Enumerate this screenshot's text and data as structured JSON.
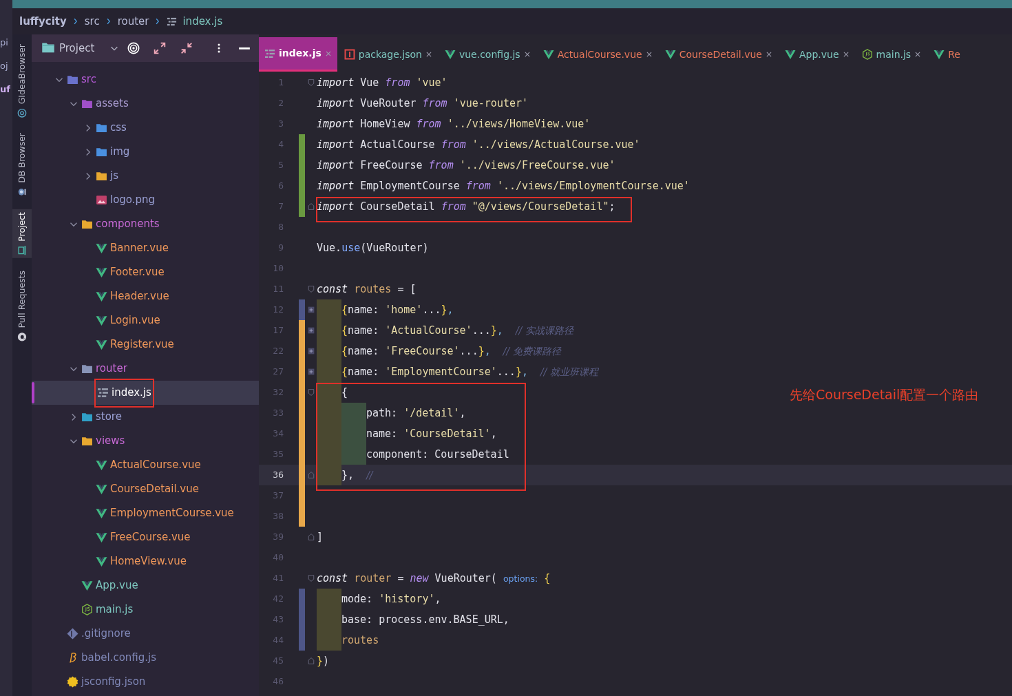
{
  "background_window": {
    "fragments": [
      "pi",
      "oj",
      "uf"
    ]
  },
  "breadcrumb": [
    {
      "label": "luffycity",
      "kind": "project"
    },
    {
      "label": "src",
      "kind": "folder"
    },
    {
      "label": "router",
      "kind": "folder"
    },
    {
      "label": "index.js",
      "kind": "file"
    }
  ],
  "tool_strip": [
    {
      "label": "GIdeaBrowser",
      "selected": false
    },
    {
      "label": "DB Browser",
      "selected": false
    },
    {
      "label": "Project",
      "selected": true
    },
    {
      "label": "Pull Requests",
      "selected": false
    }
  ],
  "project_panel": {
    "title": "Project",
    "tree": [
      {
        "label": "src",
        "kind": "src",
        "color": "#b45ad6",
        "expanded": true,
        "selected": false,
        "children": [
          {
            "label": "assets",
            "kind": "assets",
            "color": "#a99bd0",
            "expanded": true,
            "selected": false,
            "children": [
              {
                "label": "css",
                "kind": "styles",
                "color": "#9aa0d4",
                "expanded": false,
                "selected": false
              },
              {
                "label": "img",
                "kind": "images",
                "color": "#9aa0d4",
                "expanded": false,
                "selected": false
              },
              {
                "label": "js",
                "kind": "scripts",
                "color": "#9aa0d4",
                "expanded": false,
                "selected": false
              },
              {
                "label": "logo.png",
                "kind": "image",
                "color": "#9aa0d4",
                "selected": false
              }
            ]
          },
          {
            "label": "components",
            "kind": "components",
            "color": "#c86ad6",
            "expanded": true,
            "selected": false,
            "children": [
              {
                "label": "Banner.vue",
                "kind": "vue",
                "color": "#f0985a",
                "selected": false
              },
              {
                "label": "Footer.vue",
                "kind": "vue",
                "color": "#f0985a",
                "selected": false
              },
              {
                "label": "Header.vue",
                "kind": "vue",
                "color": "#f0985a",
                "selected": false
              },
              {
                "label": "Login.vue",
                "kind": "vue",
                "color": "#f0985a",
                "selected": false
              },
              {
                "label": "Register.vue",
                "kind": "vue",
                "color": "#f0985a",
                "selected": false
              }
            ]
          },
          {
            "label": "router",
            "kind": "router",
            "color": "#c86ad6",
            "expanded": true,
            "selected": false,
            "children": [
              {
                "label": "index.js",
                "kind": "list",
                "color": "#ffffff",
                "selected": true,
                "boxed": true
              }
            ]
          },
          {
            "label": "store",
            "kind": "store",
            "color": "#9aa0d4",
            "expanded": false,
            "selected": false
          },
          {
            "label": "views",
            "kind": "views",
            "color": "#c86ad6",
            "expanded": true,
            "selected": false,
            "children": [
              {
                "label": "ActualCourse.vue",
                "kind": "vue",
                "color": "#f0985a",
                "selected": false
              },
              {
                "label": "CourseDetail.vue",
                "kind": "vue",
                "color": "#f0985a",
                "selected": false
              },
              {
                "label": "EmploymentCourse.vue",
                "kind": "vue",
                "color": "#f0985a",
                "selected": false
              },
              {
                "label": "FreeCourse.vue",
                "kind": "vue",
                "color": "#f0985a",
                "selected": false
              },
              {
                "label": "HomeView.vue",
                "kind": "vue",
                "color": "#f0985a",
                "selected": false
              }
            ]
          },
          {
            "label": "App.vue",
            "kind": "vue",
            "color": "#7ec8c0",
            "selected": false
          },
          {
            "label": "main.js",
            "kind": "node",
            "color": "#7ec8c0",
            "selected": false
          }
        ]
      },
      {
        "label": ".gitignore",
        "kind": "git",
        "color": "#8088b8",
        "selected": false
      },
      {
        "label": "babel.config.js",
        "kind": "babel",
        "color": "#8088b8",
        "selected": false
      },
      {
        "label": "jsconfig.json",
        "kind": "config",
        "color": "#8088b8",
        "selected": false
      }
    ]
  },
  "editor": {
    "tabs": [
      {
        "label": "index.js",
        "kind": "list",
        "selected": true,
        "closable": true
      },
      {
        "label": "package.json",
        "kind": "package",
        "color": "#7fc8c0",
        "selected": false,
        "closable": true
      },
      {
        "label": "vue.config.js",
        "kind": "vue",
        "color": "#7fc8c0",
        "selected": false,
        "closable": true
      },
      {
        "label": "ActualCourse.vue",
        "kind": "vue",
        "color": "#e8785a",
        "selected": false,
        "closable": true
      },
      {
        "label": "CourseDetail.vue",
        "kind": "vue",
        "color": "#e8785a",
        "selected": false,
        "closable": true
      },
      {
        "label": "App.vue",
        "kind": "vue",
        "color": "#7fc8c0",
        "selected": false,
        "closable": true
      },
      {
        "label": "main.js",
        "kind": "node",
        "color": "#7fc8c0",
        "selected": false,
        "closable": true
      },
      {
        "label": "Re",
        "kind": "vue",
        "color": "#e8785a",
        "selected": false,
        "closable": false
      }
    ],
    "lines": [
      {
        "number": "1",
        "fold_start": true,
        "tokens": [
          {
            "kind": "kw",
            "text": "import"
          },
          {
            "kind": "id",
            "text": " Vue "
          },
          {
            "kind": "kw2",
            "text": "from"
          },
          {
            "kind": "str",
            "text": " 'vue'"
          }
        ]
      },
      {
        "number": "2",
        "tokens": [
          {
            "kind": "kw",
            "text": "import"
          },
          {
            "kind": "id",
            "text": " VueRouter "
          },
          {
            "kind": "kw2",
            "text": "from"
          },
          {
            "kind": "str",
            "text": " 'vue-router'"
          }
        ]
      },
      {
        "number": "3",
        "tokens": [
          {
            "kind": "kw",
            "text": "import"
          },
          {
            "kind": "id",
            "text": " HomeView "
          },
          {
            "kind": "kw2",
            "text": "from"
          },
          {
            "kind": "str",
            "text": " '../views/HomeView.vue'"
          }
        ]
      },
      {
        "number": "4",
        "color": "#6a9a40",
        "tokens": [
          {
            "kind": "kw",
            "text": "import"
          },
          {
            "kind": "id",
            "text": " ActualCourse "
          },
          {
            "kind": "kw2",
            "text": "from"
          },
          {
            "kind": "str",
            "text": " '../views/ActualCourse.vue'"
          }
        ]
      },
      {
        "number": "5",
        "color": "#6a9a40",
        "tokens": [
          {
            "kind": "kw",
            "text": "import"
          },
          {
            "kind": "id",
            "text": " FreeCourse "
          },
          {
            "kind": "kw2",
            "text": "from"
          },
          {
            "kind": "str",
            "text": " '../views/FreeCourse.vue'"
          }
        ]
      },
      {
        "number": "6",
        "color": "#6a9a40",
        "tokens": [
          {
            "kind": "kw",
            "text": "import"
          },
          {
            "kind": "id",
            "text": " EmploymentCourse "
          },
          {
            "kind": "kw2",
            "text": "from"
          },
          {
            "kind": "str",
            "text": " '../views/EmploymentCourse.vue'"
          }
        ]
      },
      {
        "number": "7",
        "color": "#6a9a40",
        "fold_end": true,
        "boxed": true,
        "tokens": [
          {
            "kind": "kw",
            "text": "import"
          },
          {
            "kind": "id",
            "text": " CourseDetail "
          },
          {
            "kind": "kw2",
            "text": "from"
          },
          {
            "kind": "str",
            "text": " \"@/views/CourseDetail\""
          },
          {
            "kind": "id",
            "text": ";"
          }
        ]
      },
      {
        "number": "8"
      },
      {
        "number": "9",
        "tokens": [
          {
            "kind": "id",
            "text": "Vue."
          },
          {
            "kind": "fn",
            "text": "use"
          },
          {
            "kind": "id",
            "text": "(VueRouter)"
          }
        ]
      },
      {
        "number": "10"
      },
      {
        "number": "11",
        "fold_start": true,
        "tokens": [
          {
            "kind": "kw",
            "text": "const"
          },
          {
            "kind": "var",
            "text": " routes"
          },
          {
            "kind": "id",
            "text": " = ["
          }
        ]
      },
      {
        "number": "12",
        "color": "#4e5688",
        "folded": true,
        "indented": true,
        "tokens": [
          {
            "kind": "brace",
            "text": "{"
          },
          {
            "kind": "id",
            "text": "name: "
          },
          {
            "kind": "str",
            "text": "'home'"
          },
          {
            "kind": "id",
            "text": "..."
          },
          {
            "kind": "brace",
            "text": "}"
          },
          {
            "kind": "punc",
            "text": ","
          }
        ]
      },
      {
        "number": "17",
        "color": "#e8a84a",
        "folded": true,
        "indented": true,
        "tokens": [
          {
            "kind": "brace",
            "text": "{"
          },
          {
            "kind": "id",
            "text": "name: "
          },
          {
            "kind": "str",
            "text": "'ActualCourse'"
          },
          {
            "kind": "id",
            "text": "..."
          },
          {
            "kind": "brace",
            "text": "}"
          },
          {
            "kind": "punc",
            "text": ",  "
          },
          {
            "kind": "comment",
            "text": "// 实战课路径"
          }
        ]
      },
      {
        "number": "22",
        "color": "#e8a84a",
        "folded": true,
        "indented": true,
        "tokens": [
          {
            "kind": "brace",
            "text": "{"
          },
          {
            "kind": "id",
            "text": "name: "
          },
          {
            "kind": "str",
            "text": "'FreeCourse'"
          },
          {
            "kind": "id",
            "text": "..."
          },
          {
            "kind": "brace",
            "text": "}"
          },
          {
            "kind": "punc",
            "text": ",  "
          },
          {
            "kind": "comment",
            "text": "// 免费课路径"
          }
        ]
      },
      {
        "number": "27",
        "color": "#e8a84a",
        "folded": true,
        "indented": true,
        "tokens": [
          {
            "kind": "brace",
            "text": "{"
          },
          {
            "kind": "id",
            "text": "name: "
          },
          {
            "kind": "str",
            "text": "'EmploymentCourse'"
          },
          {
            "kind": "id",
            "text": "..."
          },
          {
            "kind": "brace",
            "text": "}"
          },
          {
            "kind": "punc",
            "text": ",  "
          },
          {
            "kind": "comment",
            "text": "// 就业班课程"
          }
        ]
      },
      {
        "number": "32",
        "color": "#e8a84a",
        "fold_start": true,
        "indented": true,
        "boxed": true,
        "note": "先给CourseDetail配置一个路由",
        "tokens": [
          {
            "kind": "id",
            "text": "{"
          }
        ]
      },
      {
        "number": "33",
        "color": "#e8a84a",
        "indented": true,
        "nested": true,
        "boxed": true,
        "tokens": [
          {
            "kind": "id",
            "text": "path: "
          },
          {
            "kind": "str",
            "text": "'/detail'"
          },
          {
            "kind": "id",
            "text": ","
          }
        ]
      },
      {
        "number": "34",
        "color": "#e8a84a",
        "indented": true,
        "nested": true,
        "boxed": true,
        "tokens": [
          {
            "kind": "id",
            "text": "name: "
          },
          {
            "kind": "str",
            "text": "'CourseDetail'"
          },
          {
            "kind": "id",
            "text": ","
          }
        ]
      },
      {
        "number": "35",
        "color": "#e8a84a",
        "indented": true,
        "nested": true,
        "boxed": true,
        "tokens": [
          {
            "kind": "id",
            "text": "component: CourseDetail"
          }
        ]
      },
      {
        "number": "36",
        "color": "#e8a84a",
        "fold_end": true,
        "indented": true,
        "boxed": true,
        "current": true,
        "tokens": [
          {
            "kind": "id",
            "text": "},  "
          },
          {
            "kind": "comment",
            "text": "//"
          }
        ]
      },
      {
        "number": "37",
        "color": "#e8a84a"
      },
      {
        "number": "38",
        "color": "#e8a84a"
      },
      {
        "number": "39",
        "fold_end": true,
        "tokens": [
          {
            "kind": "id",
            "text": "]"
          }
        ]
      },
      {
        "number": "40"
      },
      {
        "number": "41",
        "fold_start": true,
        "tokens": [
          {
            "kind": "kw",
            "text": "const"
          },
          {
            "kind": "var",
            "text": " router"
          },
          {
            "kind": "id",
            "text": " = "
          },
          {
            "kind": "kw2",
            "text": "new"
          },
          {
            "kind": "id",
            "text": " VueRouter( "
          },
          {
            "kind": "hint",
            "text": "options:"
          },
          {
            "kind": "brace",
            "text": " {"
          }
        ]
      },
      {
        "number": "42",
        "color": "#4e5688",
        "indented": true,
        "tokens": [
          {
            "kind": "id",
            "text": "mode: "
          },
          {
            "kind": "str",
            "text": "'history'"
          },
          {
            "kind": "id",
            "text": ","
          }
        ]
      },
      {
        "number": "43",
        "color": "#4e5688",
        "indented": true,
        "tokens": [
          {
            "kind": "id",
            "text": "base: process.env.BASE_URL,"
          }
        ]
      },
      {
        "number": "44",
        "color": "#4e5688",
        "indented": true,
        "tokens": [
          {
            "kind": "var",
            "text": "routes"
          }
        ]
      },
      {
        "number": "45",
        "fold_end": true,
        "tokens": [
          {
            "kind": "brace",
            "text": "}"
          },
          {
            "kind": "id",
            "text": ")"
          }
        ]
      },
      {
        "number": "46"
      }
    ]
  }
}
